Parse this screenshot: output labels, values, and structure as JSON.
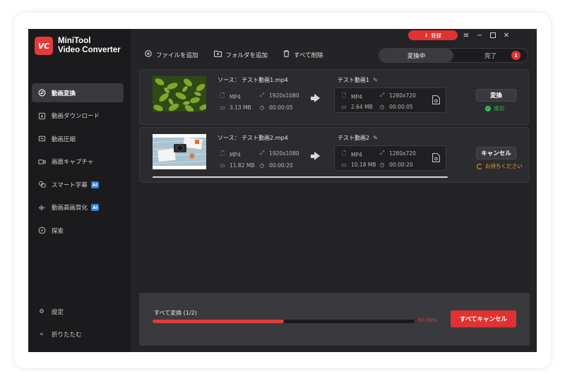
{
  "app": {
    "logo_text": "VC",
    "name_line1": "MiniTool",
    "name_line2": "Video Converter"
  },
  "sidebar": {
    "items": [
      {
        "label": "動画変換",
        "icon": "convert-icon",
        "active": true,
        "ai": false
      },
      {
        "label": "動画ダウンロード",
        "icon": "download-icon",
        "active": false,
        "ai": false
      },
      {
        "label": "動画圧縮",
        "icon": "compress-icon",
        "active": false,
        "ai": false
      },
      {
        "label": "画面キャプチャ",
        "icon": "camera-icon",
        "active": false,
        "ai": false
      },
      {
        "label": "スマート字幕",
        "icon": "subtitle-icon",
        "active": false,
        "ai": true
      },
      {
        "label": "動画高画質化",
        "icon": "waveform-icon",
        "active": false,
        "ai": true
      },
      {
        "label": "探索",
        "icon": "compass-icon",
        "active": false,
        "ai": false
      }
    ],
    "ai_badge": "AI",
    "settings_label": "設定",
    "collapse_label": "折りたたむ"
  },
  "titlebar": {
    "login_label": "登録"
  },
  "toolbar": {
    "add_file": "ファイルを追加",
    "add_folder": "フォルダを追加",
    "delete_all": "すべて削除"
  },
  "tabs": {
    "converting": "変換中",
    "done": "完了",
    "done_badge": "1"
  },
  "tasks": [
    {
      "source_label": "ソース：",
      "source_name": "テスト動画1.mp4",
      "src_format": "MP4",
      "src_resolution": "1920x1080",
      "src_size": "3.13 MB",
      "src_duration": "00:00:05",
      "target_name": "テスト動画1",
      "dst_format": "MP4",
      "dst_resolution": "1280x720",
      "dst_size": "2.64 MB",
      "dst_duration": "00:00:05",
      "action_label": "変換",
      "status_label": "成功",
      "status_color": "#36c05a"
    },
    {
      "source_label": "ソース：",
      "source_name": "テスト動画2.mp4",
      "src_format": "MP4",
      "src_resolution": "1920x1080",
      "src_size": "11.82 MB",
      "src_duration": "00:00:20",
      "target_name": "テスト動画2",
      "dst_format": "MP4",
      "dst_resolution": "1280x720",
      "dst_size": "10.18 MB",
      "dst_duration": "00:00:20",
      "action_label": "キャンセル",
      "status_label": "お待ちください",
      "status_color": "#e7a23a",
      "progress": 1.0
    }
  ],
  "footer": {
    "all_label": "すべて変換 (1/2)",
    "percent_text": "50.00%",
    "progress": 0.5,
    "cancel_all_label": "すべてキャンセル",
    "accent_color": "#e03232"
  }
}
